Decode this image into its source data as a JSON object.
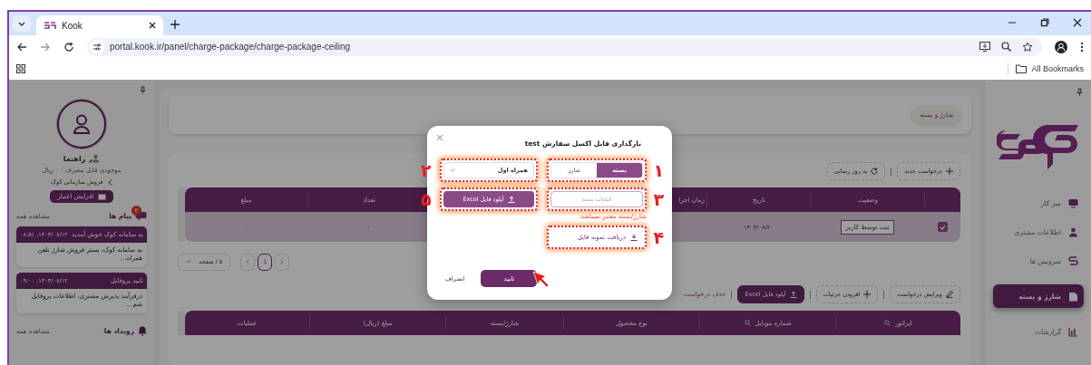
{
  "browser": {
    "tab_title": "Kook",
    "url": "portal.kook.ir/panel/charge-package/charge-package-ceiling",
    "bookmarks_label": "All Bookmarks"
  },
  "nav": {
    "items": [
      {
        "label": "میز کار",
        "kind": "desk",
        "selected": false
      },
      {
        "label": "اطلاعات مشتری",
        "kind": "customer",
        "selected": false
      },
      {
        "label": "سرویس ها",
        "kind": "services",
        "selected": false
      },
      {
        "label": "شارژ و بسته",
        "kind": "charge",
        "selected": true
      },
      {
        "label": "گزارشات",
        "kind": "reports",
        "selected": false
      }
    ]
  },
  "breadcrumb": {
    "label": "شارژ و بسته"
  },
  "requests": {
    "actions": [
      {
        "label": "درخواست جدید",
        "kind": "add"
      },
      {
        "label": "به روز رسانی",
        "kind": "refresh"
      }
    ],
    "columns": [
      {
        "label": "وضعیت"
      },
      {
        "label": "تاریخ"
      },
      {
        "label": "زمان اجرا"
      },
      {
        "label": "تعداد"
      },
      {
        "label": "مبلغ"
      }
    ],
    "rows": [
      {
        "checked": true,
        "cells": [
          {
            "kind": "tag",
            "text": "ثبت توسط کاربر"
          },
          {
            "kind": "text",
            "text": "۱۴۰۳/۰۸/۲۰"
          },
          {},
          {
            "kind": "text",
            "text": "۰"
          },
          {
            "kind": "text",
            "text": "۰"
          }
        ]
      }
    ],
    "pagination": {
      "pages": [
        {
          "label": "1",
          "selected": true
        }
      ],
      "page_size": "۵ / صفحه"
    }
  },
  "details": {
    "actions": [
      {
        "label": "ویرایش درخواست",
        "kind": "edit"
      },
      {
        "label": "افزودن جزئیات",
        "kind": "add"
      },
      {
        "label": "آپلود فایل Excel",
        "kind": "upload"
      },
      {
        "label": "حذف درخواست",
        "kind": "link"
      }
    ],
    "columns": [
      {
        "label": "اپراتور",
        "searchable": true
      },
      {
        "label": "شماره موبایل",
        "searchable": true
      },
      {
        "label": "نوع محصول",
        "searchable": false
      },
      {
        "label": "شارژ/بسته",
        "searchable": false
      },
      {
        "label": "مبلغ (ریال)",
        "searchable": false
      },
      {
        "label": "عملیات",
        "searchable": false
      }
    ]
  },
  "profile": {
    "name": "راهنما",
    "balance": "موجودی قابل مصرف : ۰ ریال",
    "organization": "فروش سازمانی کوک",
    "credit_button": "افزایش اعتبار"
  },
  "messages": {
    "title": "پیام ها",
    "badge": "۲",
    "view_all": "مشاهده همه",
    "items": [
      {
        "title": "به سامانه کوک خوش آمدید",
        "time": "۱۴۰۳/۰۸/۱۲, ۰۸:۵۱",
        "body": "به سامانه کوک، بستر فروش شارژ تلفن همراه..."
      },
      {
        "title": "تایید پروفایل",
        "time": "۱۴۰۳/۰۸/۱۲, ۰۹:۰۰",
        "body": "درفرآیند پذیرش مشتری، اطلاعات پروفایل شم..."
      }
    ]
  },
  "events": {
    "title": "رویداد ها",
    "view_all": "مشاهده همه"
  },
  "modal": {
    "title": "بارگذاری فایل اکسل سفارش test",
    "segments": [
      {
        "label": "بسته",
        "selected": true
      },
      {
        "label": "شارژ",
        "selected": false
      }
    ],
    "segments_annotation": "۱",
    "operator_select": {
      "value": "همراه اول",
      "annotation": "۲"
    },
    "package_field": {
      "placeholder": "انتخاب بسته",
      "annotation": "۳",
      "error": "شارژ/بسته معتبر نمیباشد."
    },
    "sample_link": {
      "label": "دریافت نمونه فایل",
      "annotation": "۴"
    },
    "upload_button": {
      "label": "آپلود فایل Excel",
      "annotation": "۵"
    },
    "confirm": "تایید",
    "cancel": "انصراف"
  }
}
